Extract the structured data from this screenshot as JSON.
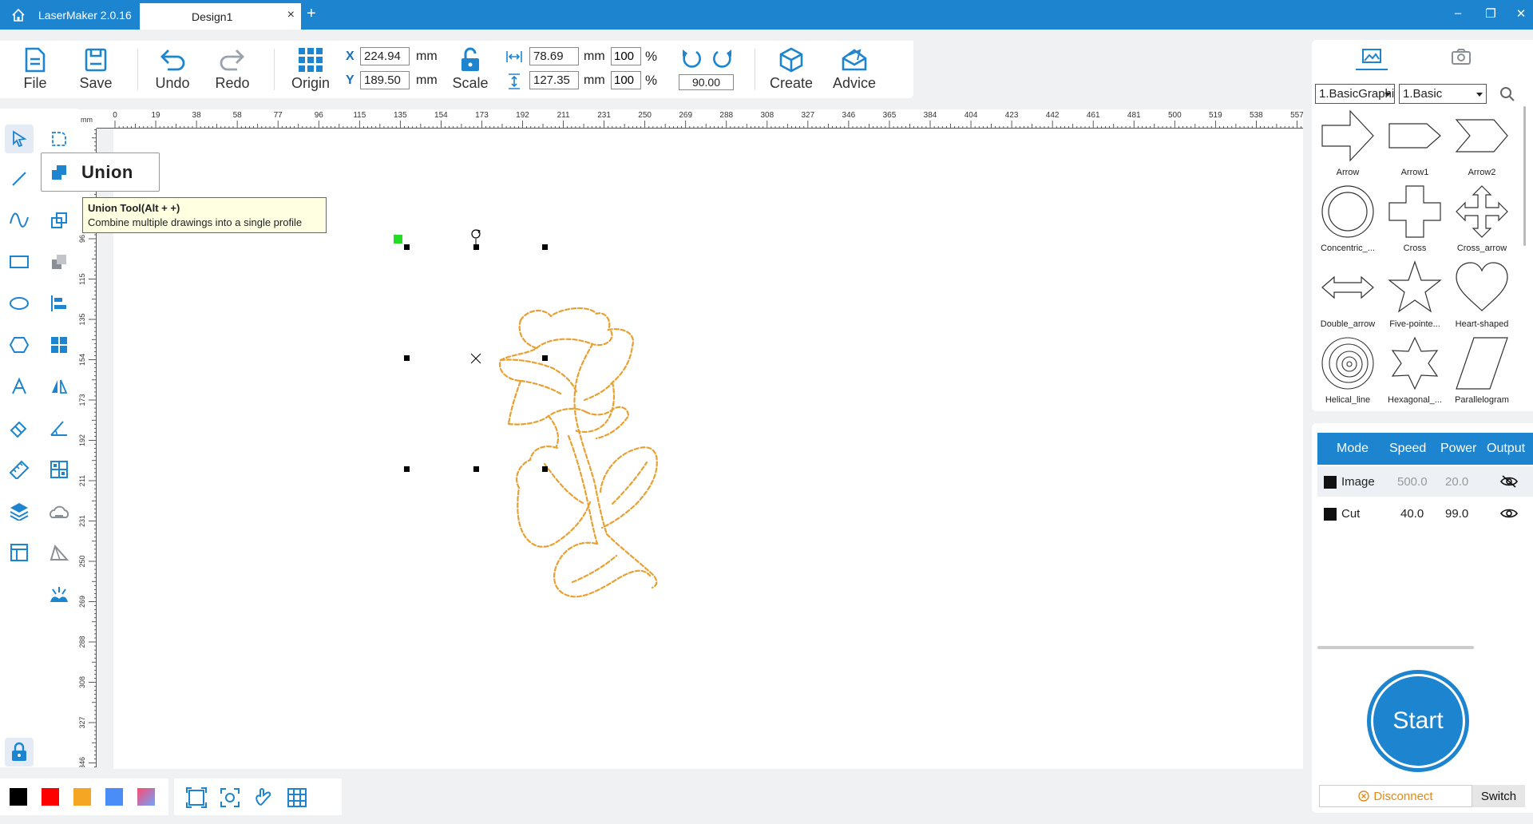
{
  "titlebar": {
    "app_name": "LaserMaker 2.0.16",
    "tab_name": "Design1",
    "tab_close": "×",
    "tab_add": "+",
    "minimize": "–",
    "restore": "❐",
    "close": "✕"
  },
  "toolbar": {
    "file": "File",
    "save": "Save",
    "undo": "Undo",
    "redo": "Redo",
    "origin": "Origin",
    "scale": "Scale",
    "create": "Create",
    "advice": "Advice",
    "x_label": "X",
    "y_label": "Y",
    "x_value": "224.94",
    "y_value": "189.50",
    "width_value": "78.69",
    "height_value": "127.35",
    "width_pct": "100",
    "height_pct": "100",
    "unit": "mm",
    "pct": "%",
    "rotation_value": "90.00"
  },
  "ruler": {
    "unit": "mm",
    "top_ticks": [
      "0",
      "19",
      "38",
      "58",
      "77",
      "96",
      "115",
      "135",
      "154",
      "173",
      "192",
      "211",
      "231",
      "250",
      "269",
      "288",
      "308",
      "327",
      "346",
      "365",
      "384",
      "404",
      "423",
      "442",
      "461",
      "481",
      "500",
      "519",
      "538",
      "557"
    ],
    "left_ticks": [
      "96",
      "115",
      "135",
      "154",
      "173",
      "192",
      "211",
      "231",
      "250",
      "269",
      "288",
      "308",
      "327",
      "346"
    ]
  },
  "flyout": {
    "label": "Union"
  },
  "tooltip": {
    "title": "Union Tool(Alt + +)",
    "body": "Combine multiple drawings into a single profile"
  },
  "colors": {
    "accent": "#1d84d0",
    "path": "#e8a032",
    "swatches": [
      "#000000",
      "#ff0000",
      "#f5a623",
      "#4a8df8",
      "gradient-pink-blue"
    ]
  },
  "library": {
    "category": "1.BasicGraphics",
    "subcategory": "1.Basic",
    "shapes": [
      "Arrow",
      "Arrow1",
      "Arrow2",
      "Concentric_...",
      "Cross",
      "Cross_arrow",
      "Double_arrow",
      "Five-pointe...",
      "Heart-shaped",
      "Helical_line",
      "Hexagonal_...",
      "Parallelogram"
    ]
  },
  "layers": {
    "headers": [
      "Mode",
      "Speed",
      "Power",
      "Output"
    ],
    "rows": [
      {
        "mode": "Image",
        "speed": "500.0",
        "power": "20.0",
        "output": "hidden"
      },
      {
        "mode": "Cut",
        "speed": "40.0",
        "power": "99.0",
        "output": "visible"
      }
    ]
  },
  "controls": {
    "start": "Start",
    "disconnect": "Disconnect",
    "switch": "Switch"
  }
}
